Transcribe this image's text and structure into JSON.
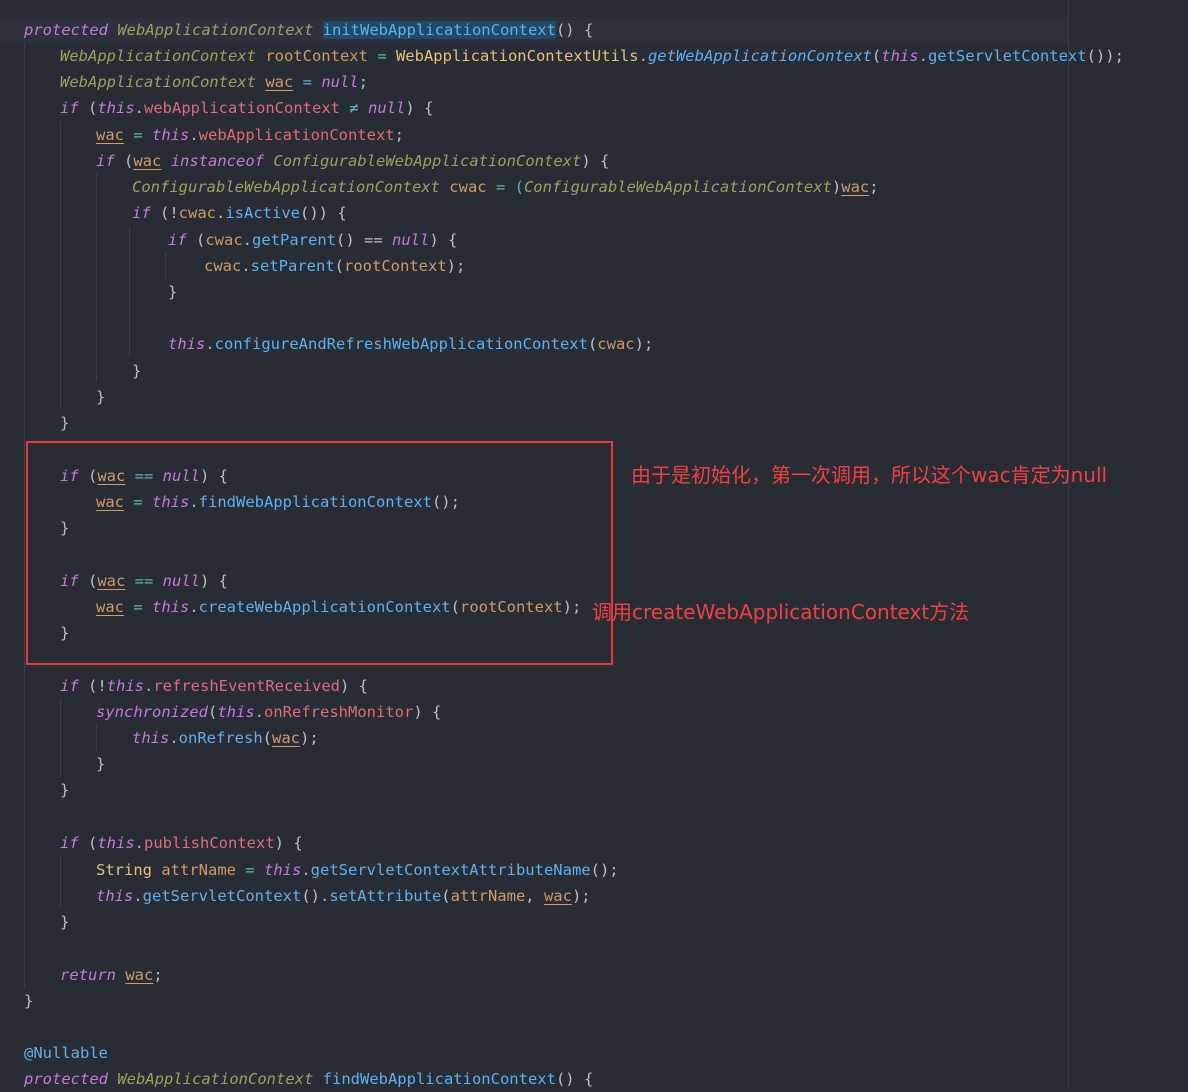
{
  "annotations": {
    "note1": "由于是初始化，第一次调用，所以这个wac肯定为null",
    "note2": "调用createWebApplicationContext方法"
  },
  "code": {
    "l1_kw": "protected",
    "l1_type": "WebApplicationContext",
    "l1_fn": "initWebApplicationContext",
    "l1_rest": "() {",
    "l2_type": "WebApplicationContext",
    "l2_var": "rootContext",
    "l2_eq": " = ",
    "l2_cls": "WebApplicationContextUtils",
    "l2_dot": ".",
    "l2_fn": "getWebApplicationContext",
    "l2_p": "(",
    "l2_this": "this",
    "l2_fn2": "getServletContext",
    "l2_end": "());",
    "l3_type": "WebApplicationContext",
    "l3_wac": "wac",
    "l3_eq": " = ",
    "l3_null": "null",
    "l3_end": ";",
    "l4_if": "if",
    "l4_p": " (",
    "l4_this": "this",
    "l4_fld": "webApplicationContext",
    "l4_ne": " ≠ ",
    "l4_null": "null",
    "l4_end": ") {",
    "l5_wac": "wac",
    "l5_eq": " = ",
    "l5_this": "this",
    "l5_fld": "webApplicationContext",
    "l5_end": ";",
    "l6_if": "if",
    "l6_p": " (",
    "l6_wac": "wac",
    "l6_inst": "instanceof",
    "l6_type": "ConfigurableWebApplicationContext",
    "l6_end": ") {",
    "l7_type": "ConfigurableWebApplicationContext",
    "l7_var": "cwac",
    "l7_eq": " = (",
    "l7_type2": "ConfigurableWebApplicationContext",
    "l7_cp": ")",
    "l7_wac": "wac",
    "l7_end": ";",
    "l8_if": "if",
    "l8_p": " (!",
    "l8_var": "cwac",
    "l8_fn": "isActive",
    "l8_end": "()) {",
    "l9_if": "if",
    "l9_p": " (",
    "l9_var": "cwac",
    "l9_fn": "getParent",
    "l9_mid": "() == ",
    "l9_null": "null",
    "l9_end": ") {",
    "l10_var": "cwac",
    "l10_fn": "setParent",
    "l10_p": "(",
    "l10_arg": "rootContext",
    "l10_end": ");",
    "l11": "}",
    "l12_this": "this",
    "l12_fn": "configureAndRefreshWebApplicationContext",
    "l12_p": "(",
    "l12_arg": "cwac",
    "l12_end": ");",
    "l13": "}",
    "l14": "}",
    "l15": "}",
    "l16_if": "if",
    "l16_p": " (",
    "l16_wac": "wac",
    "l16_eq": " == ",
    "l16_null": "null",
    "l16_end": ") {",
    "l17_wac": "wac",
    "l17_eq": " = ",
    "l17_this": "this",
    "l17_fn": "findWebApplicationContext",
    "l17_end": "();",
    "l18": "}",
    "l19_if": "if",
    "l19_p": " (",
    "l19_wac": "wac",
    "l19_eq": " == ",
    "l19_null": "null",
    "l19_end": ") {",
    "l20_wac": "wac",
    "l20_eq": " = ",
    "l20_this": "this",
    "l20_fn": "createWebApplicationContext",
    "l20_p": "(",
    "l20_arg": "rootContext",
    "l20_end": ");",
    "l21": "}",
    "l22_if": "if",
    "l22_p": " (!",
    "l22_this": "this",
    "l22_fld": "refreshEventReceived",
    "l22_end": ") {",
    "l23_sync": "synchronized",
    "l23_p": "(",
    "l23_this": "this",
    "l23_fld": "onRefreshMonitor",
    "l23_end": ") {",
    "l24_this": "this",
    "l24_fn": "onRefresh",
    "l24_p": "(",
    "l24_wac": "wac",
    "l24_end": ");",
    "l25": "}",
    "l26": "}",
    "l27_if": "if",
    "l27_p": " (",
    "l27_this": "this",
    "l27_fld": "publishContext",
    "l27_end": ") {",
    "l28_cls": "String",
    "l28_var": "attrName",
    "l28_eq": " = ",
    "l28_this": "this",
    "l28_fn": "getServletContextAttributeName",
    "l28_end": "();",
    "l29_this": "this",
    "l29_fn": "getServletContext",
    "l29_mid": "().",
    "l29_fn2": "setAttribute",
    "l29_p": "(",
    "l29_arg": "attrName",
    "l29_comma": ", ",
    "l29_wac": "wac",
    "l29_end": ");",
    "l30": "}",
    "l31_ret": "return",
    "l31_wac": "wac",
    "l31_end": ";",
    "l32": "}",
    "l33_ann": "@Nullable",
    "l34_kw": "protected",
    "l34_type": "WebApplicationContext",
    "l34_fn": "findWebApplicationContext",
    "l34_end": "() {"
  }
}
